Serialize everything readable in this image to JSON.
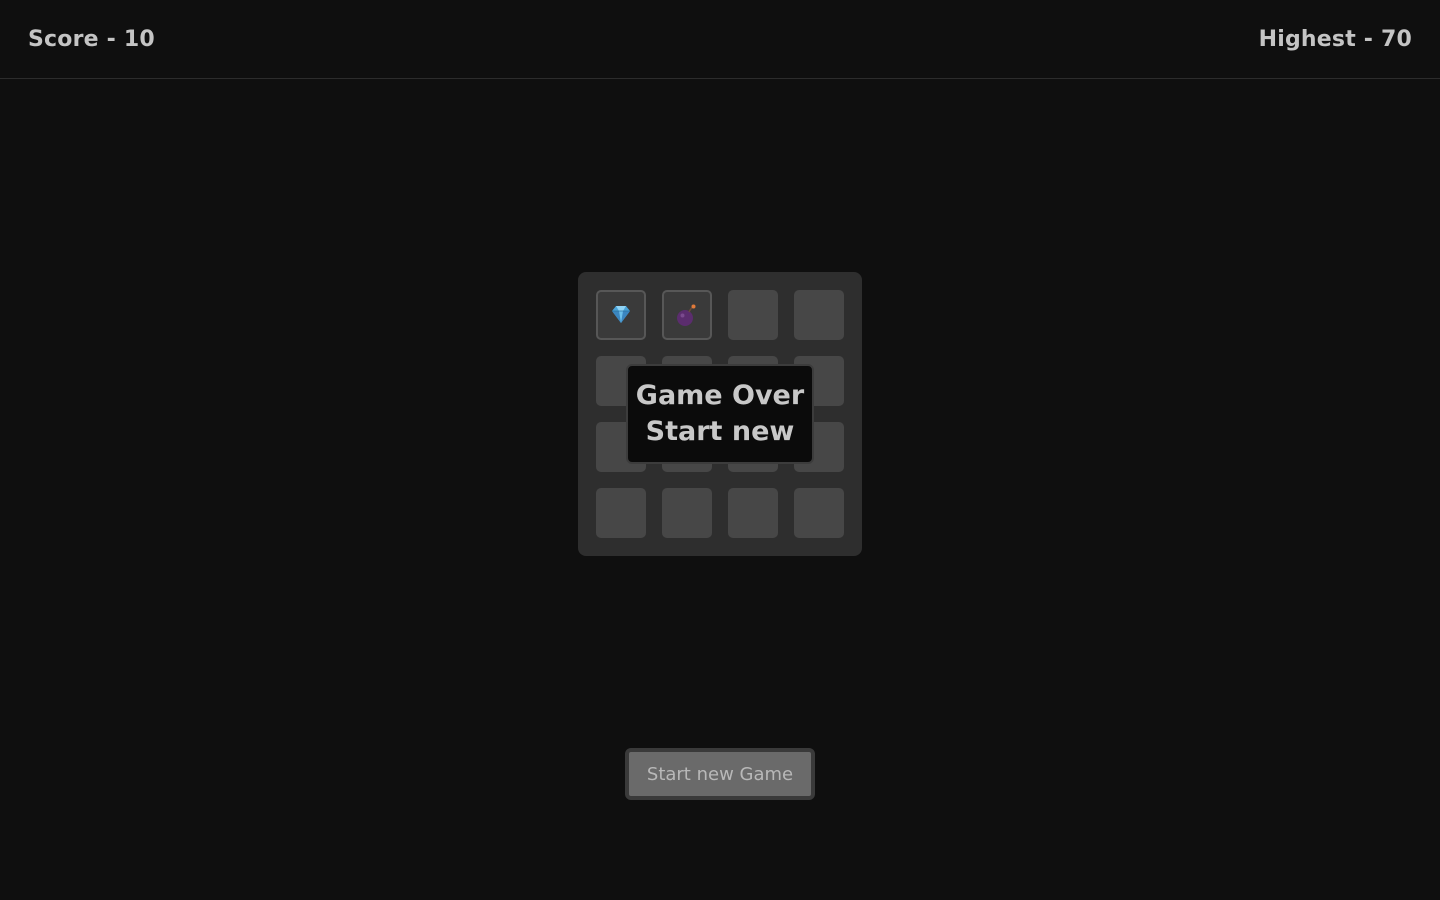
{
  "header": {
    "score_text": "Score - 10",
    "highest_text": "Highest - 70"
  },
  "board": {
    "rows": 4,
    "cols": 4,
    "cells": [
      {
        "state": "revealed",
        "content": "diamond-icon"
      },
      {
        "state": "revealed",
        "content": "bomb-icon"
      },
      {
        "state": "hidden"
      },
      {
        "state": "hidden"
      },
      {
        "state": "hidden"
      },
      {
        "state": "hidden"
      },
      {
        "state": "hidden"
      },
      {
        "state": "hidden"
      },
      {
        "state": "hidden"
      },
      {
        "state": "hidden"
      },
      {
        "state": "hidden"
      },
      {
        "state": "hidden"
      },
      {
        "state": "hidden"
      },
      {
        "state": "hidden"
      },
      {
        "state": "hidden"
      },
      {
        "state": "hidden"
      }
    ]
  },
  "overlay": {
    "line1": "Game Over",
    "line2": "Start new"
  },
  "controls": {
    "start_new_game_label": "Start new Game"
  },
  "colors": {
    "background": "#0f0f0f",
    "board": "#2e2e2e",
    "tile": "#474747",
    "button": "#6a6a6a",
    "diamond": "#4aa3d8",
    "bomb": "#5b2d6e",
    "fuse": "#e07a3a"
  }
}
